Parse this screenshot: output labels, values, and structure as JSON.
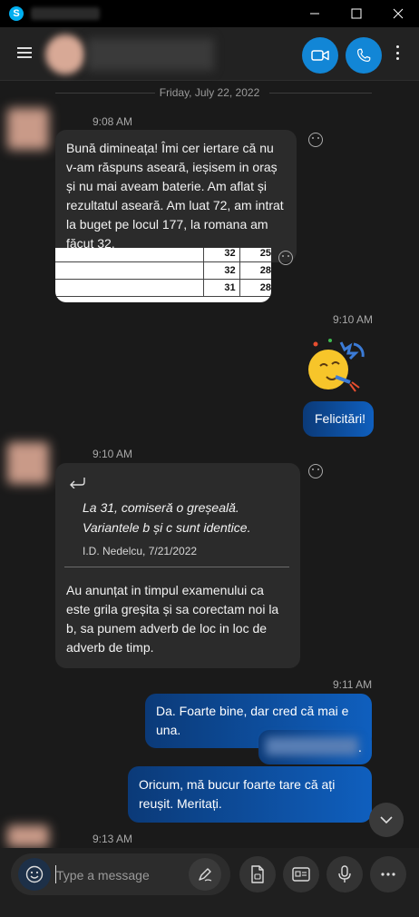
{
  "window": {
    "logo_letter": "S",
    "title": ""
  },
  "header": {
    "contact_name": ""
  },
  "date_separator": "Friday, July 22, 2022",
  "messages": {
    "m1": {
      "time": "9:08 AM",
      "text": "Bună dimineața! Îmi cer iertare că nu v-am răspuns aseară, ieșisem in oraș și nu mai aveam baterie. Am aflat și rezultatul aseară. Am luat 72, am intrat la buget pe locul 177, la romana am făcut 32."
    },
    "attachment_table": [
      [
        "",
        "32",
        "25"
      ],
      [
        "",
        "32",
        "28"
      ],
      [
        "",
        "31",
        "28"
      ]
    ],
    "m2": {
      "time": "9:10 AM",
      "text": "Felicitări!"
    },
    "m3": {
      "time": "9:10 AM",
      "quote_text": "La 31, comiseră o greșeală. Variantele b și c sunt identice.",
      "quote_author": "I.D. Nedelcu, 7/21/2022",
      "text": "Au anunțat in timpul examenului ca este grila greșita și sa corectam noi la b, sa punem adverb de loc in loc de adverb de timp."
    },
    "m4": {
      "time": "9:11 AM",
      "text1": "Da. Foarte bine, dar cred că mai e una.",
      "text2": ".",
      "text3": "Oricum, mă bucur foarte tare că ați reușit. Meritați."
    },
    "m5": {
      "time": "9:13 AM"
    }
  },
  "composer": {
    "placeholder": "Type a message"
  },
  "colors": {
    "accent": "#1286d6",
    "outgoing_bubble": "#0f5fbe",
    "incoming_bubble": "#2b2b2b",
    "background": "#1a1a1a"
  },
  "icons": [
    "skype-logo",
    "minimize-icon",
    "maximize-icon",
    "close-icon",
    "menu-icon",
    "video-call-icon",
    "audio-call-icon",
    "more-options-icon",
    "reaction-smiley-icon",
    "reply-arrow-icon",
    "scroll-down-chevron-icon",
    "emoji-icon",
    "pen-icon",
    "file-icon",
    "contact-card-icon",
    "microphone-icon",
    "more-horizontal-icon"
  ]
}
